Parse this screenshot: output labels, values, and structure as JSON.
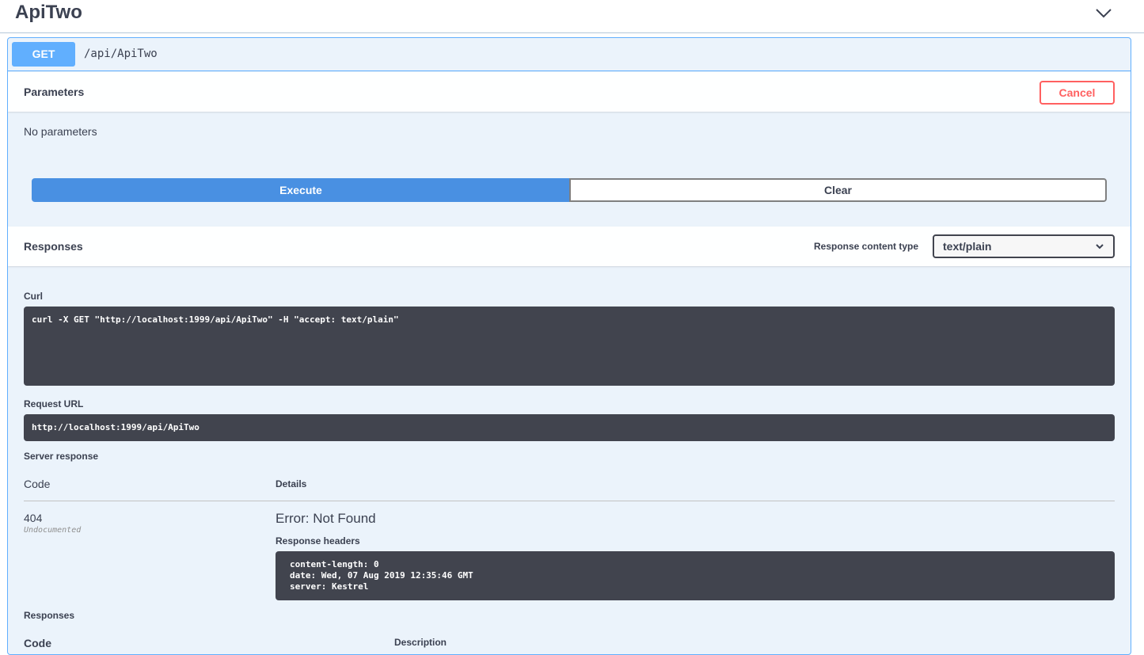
{
  "tag": {
    "title": "ApiTwo"
  },
  "operation": {
    "method": "GET",
    "path": "/api/ApiTwo"
  },
  "parameters": {
    "title": "Parameters",
    "cancel_label": "Cancel",
    "empty_text": "No parameters"
  },
  "actions": {
    "execute_label": "Execute",
    "clear_label": "Clear"
  },
  "responses_header": {
    "title": "Responses",
    "content_type_label": "Response content type",
    "content_type_value": "text/plain"
  },
  "curl": {
    "label": "Curl",
    "command": "curl -X GET \"http://localhost:1999/api/ApiTwo\" -H \"accept: text/plain\""
  },
  "request_url": {
    "label": "Request URL",
    "value": "http://localhost:1999/api/ApiTwo"
  },
  "server_response": {
    "label": "Server response",
    "code_header": "Code",
    "details_header": "Details",
    "code": "404",
    "code_note": "Undocumented",
    "error": "Error: Not Found",
    "headers_label": "Response headers",
    "headers": [
      "content-length: 0",
      "date: Wed, 07 Aug 2019 12:35:46 GMT",
      "server: Kestrel"
    ]
  },
  "responses_footer": {
    "title": "Responses",
    "code_header": "Code",
    "description_header": "Description"
  },
  "colors": {
    "get": "#61affe",
    "execute": "#4990e2",
    "cancel": "#ff6060",
    "code_bg": "#41444e",
    "block_bg": "#ebf3fb"
  }
}
